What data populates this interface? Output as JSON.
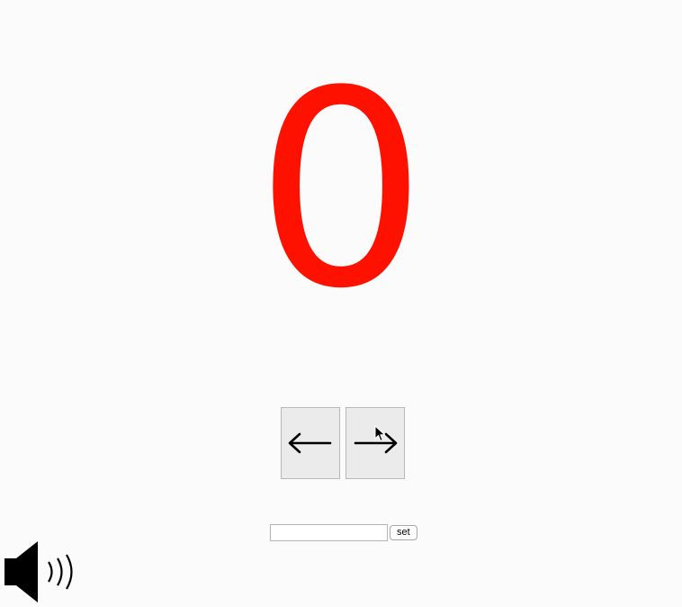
{
  "counter": {
    "value": "0",
    "color": "#ff1100"
  },
  "navigation": {
    "prev_icon": "left-arrow-icon",
    "next_icon": "right-arrow-icon"
  },
  "set_form": {
    "input_value": "",
    "button_label": "set"
  },
  "sound": {
    "icon": "speaker-icon"
  }
}
